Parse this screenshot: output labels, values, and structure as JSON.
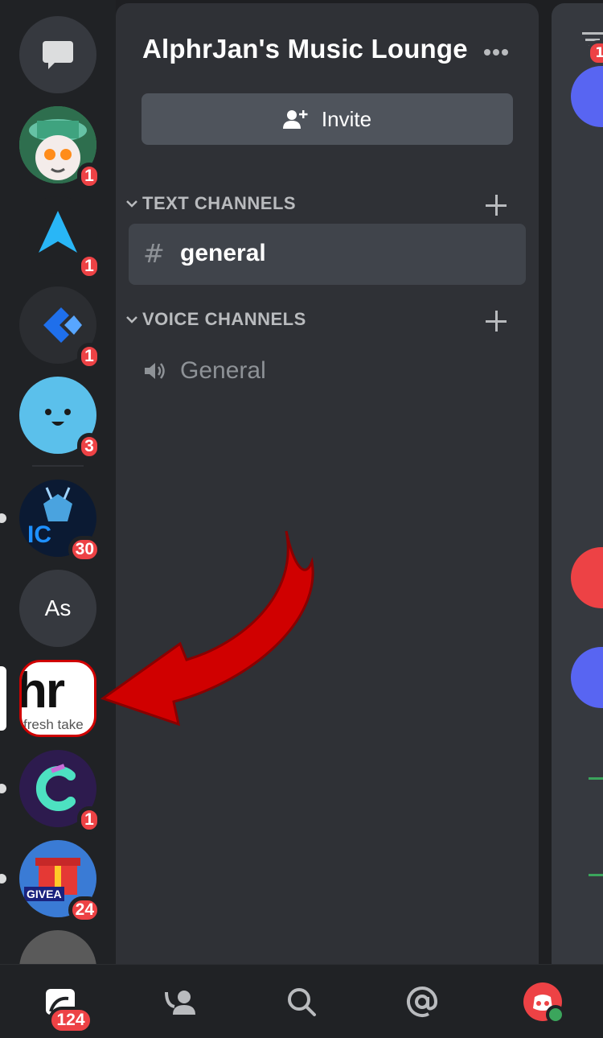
{
  "server": {
    "name": "AlphrJan's Music Lounge",
    "invite_label": "Invite"
  },
  "categories": {
    "text": "TEXT CHANNELS",
    "voice": "VOICE CHANNELS"
  },
  "channels": {
    "text": [
      {
        "name": "general",
        "icon": "hash-icon"
      }
    ],
    "voice": [
      {
        "name": "General",
        "icon": "speaker-icon"
      }
    ]
  },
  "rail": {
    "servers": [
      {
        "kind": "direct-messages",
        "badge": ""
      },
      {
        "kind": "avatar-character",
        "badge": "1"
      },
      {
        "kind": "avatar-arrow-logo",
        "badge": "1"
      },
      {
        "kind": "avatar-blue-diamond",
        "badge": "1"
      },
      {
        "kind": "avatar-smiley",
        "badge": "3"
      },
      {
        "kind": "avatar-dragon",
        "badge": "30",
        "text": "IC"
      },
      {
        "kind": "avatar-initials",
        "text": "As",
        "badge": ""
      },
      {
        "kind": "avatar-alphr",
        "text": "hr",
        "subtext": "fresh take",
        "badge": "",
        "selected": true
      },
      {
        "kind": "avatar-c-logo",
        "badge": "1"
      },
      {
        "kind": "avatar-giveaway",
        "text": "GIVEA",
        "badge": "24"
      },
      {
        "kind": "avatar-partial",
        "badge": ""
      }
    ]
  },
  "right": {
    "filter_badge": "1"
  },
  "bottom_nav": {
    "home_badge": "124",
    "items": [
      "home-icon",
      "friends-icon",
      "search-icon",
      "mentions-icon",
      "profile-avatar"
    ]
  },
  "colors": {
    "accent_red": "#ed4245",
    "rail_bg": "#202225",
    "panel_bg": "#2f3136",
    "selected_bg": "#40444b",
    "arrow_red": "#d00000"
  }
}
